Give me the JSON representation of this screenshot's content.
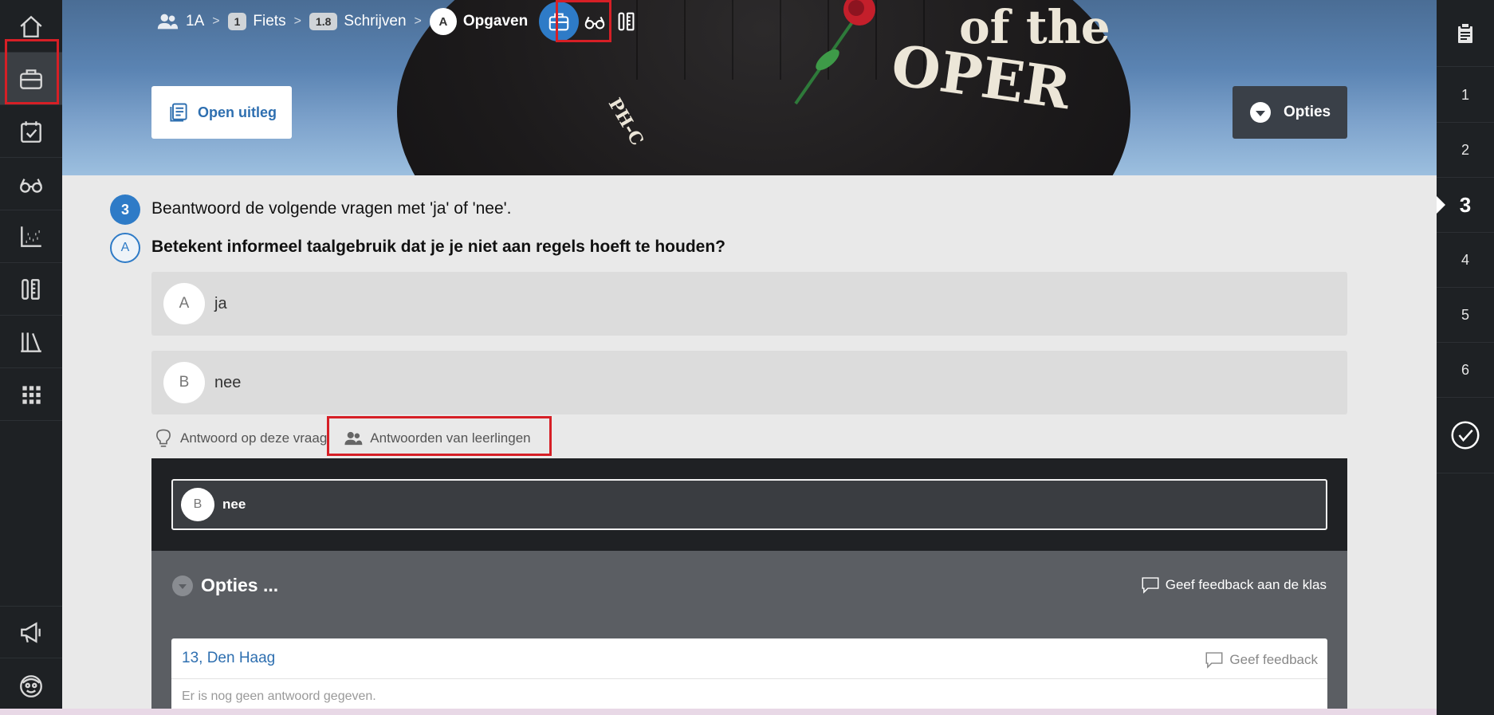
{
  "breadcrumb": {
    "class_label": "1A",
    "chapter_num": "1",
    "chapter_label": "Fiets",
    "section_num": "1.8",
    "section_label": "Schrijven",
    "part_letter": "A",
    "part_label": "Opgaven"
  },
  "hero": {
    "open_uitleg_label": "Open uitleg",
    "opties_label": "Opties",
    "balloon_text_1": "of the",
    "balloon_text_2": "OPER",
    "balloon_text_3": "PH-C"
  },
  "question": {
    "number": "3",
    "instruction": "Beantwoord de volgende vragen met 'ja' of 'nee'.",
    "letter": "A",
    "text": "Betekent informeel taalgebruik dat je je niet aan regels hoeft te houden?",
    "choices": [
      {
        "letter": "A",
        "label": "ja"
      },
      {
        "letter": "B",
        "label": "nee"
      }
    ]
  },
  "tabs": {
    "answer_label": "Antwoord op deze vraag",
    "students_label": "Antwoorden van leerlingen"
  },
  "answers_panel": {
    "selected_letter": "B",
    "selected_label": "nee",
    "options_title": "Opties ...",
    "class_feedback_label": "Geef feedback aan de klas",
    "student_name": "13, Den Haag",
    "student_feedback_label": "Geef feedback",
    "student_empty_text": "Er is nog geen antwoord gegeven."
  },
  "right_nav": {
    "items": [
      "1",
      "2",
      "3",
      "4",
      "5",
      "6"
    ],
    "current": "3"
  },
  "colors": {
    "accent": "#2e7bc7",
    "highlight": "#d61f26",
    "sidebar": "#1e2124"
  },
  "icons": {
    "left_sidebar": [
      "home-icon",
      "briefcase-icon",
      "calendar-check-icon",
      "glasses-icon",
      "scatter-chart-icon",
      "tools-icon",
      "library-icon",
      "grid-icon",
      "megaphone-icon",
      "avatar-icon"
    ],
    "right_sidebar": [
      "clipboard-icon",
      "check-circle-icon"
    ]
  }
}
